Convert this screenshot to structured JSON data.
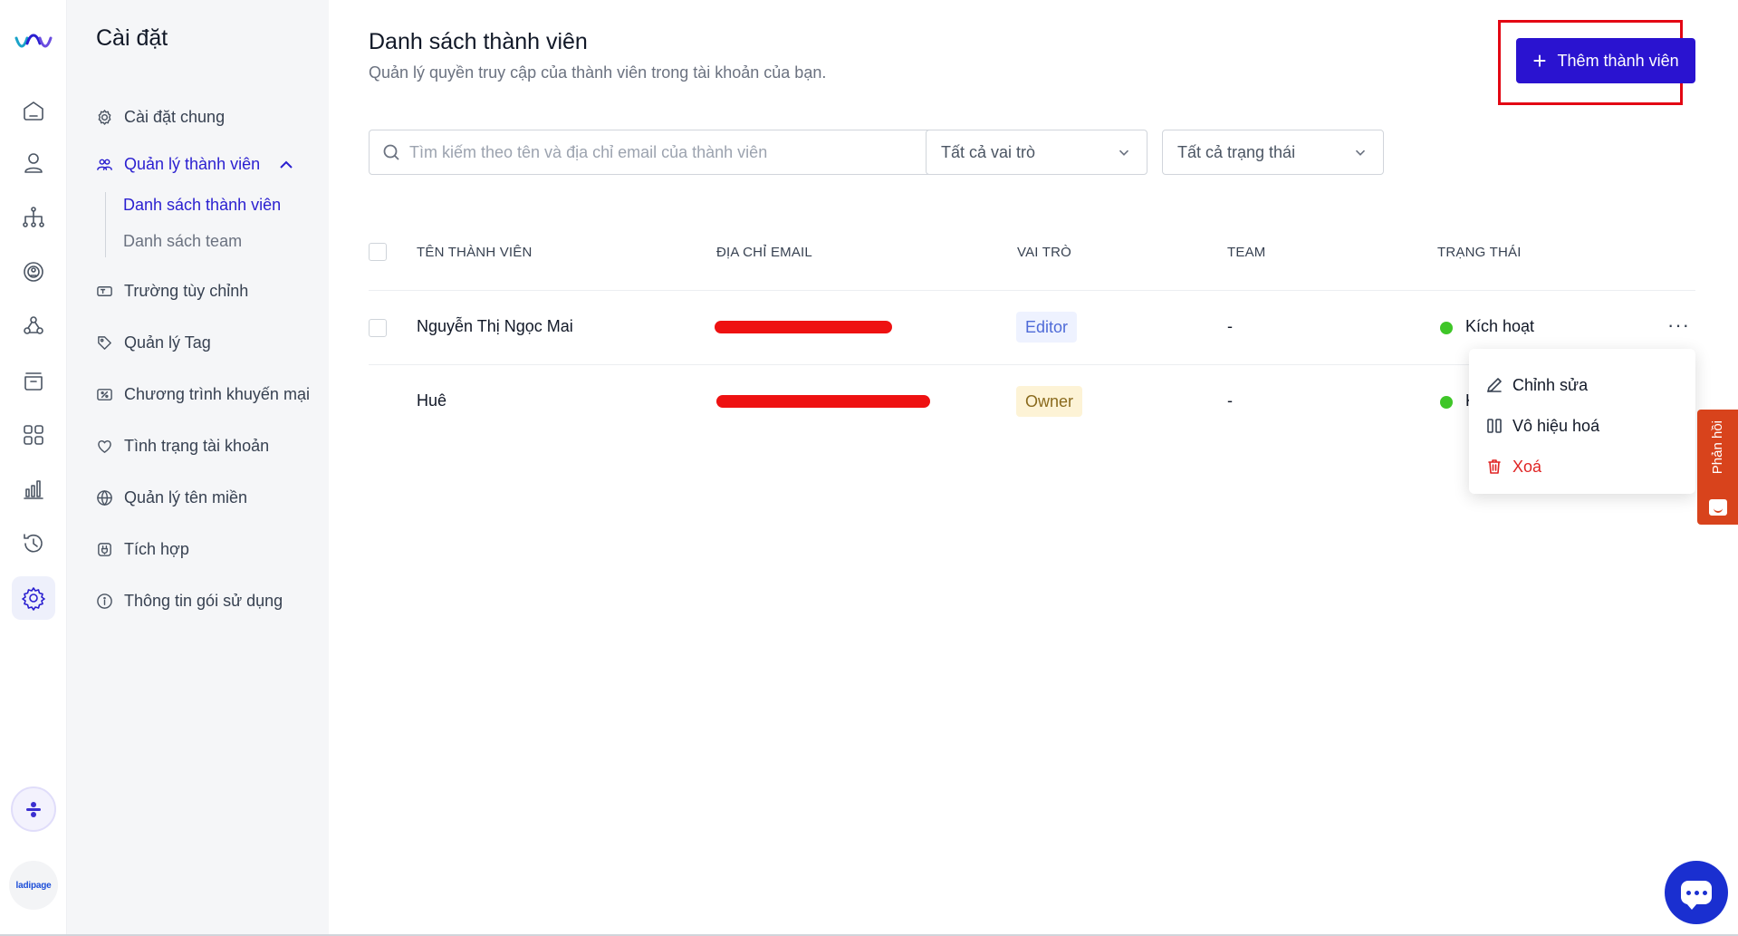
{
  "rail": {
    "icons": [
      "home-icon",
      "user-icon",
      "org-chart-icon",
      "broadcast-icon",
      "group-icon",
      "box-icon",
      "apps-icon",
      "bar-chart-icon",
      "history-icon",
      "settings-icon"
    ],
    "active": "settings-icon",
    "brand_label": "ladipage"
  },
  "sidebar": {
    "title": "Cài đặt",
    "items": [
      {
        "label": "Cài đặt chung",
        "icon": "gear-icon"
      },
      {
        "label": "Quản lý thành viên",
        "icon": "users-icon",
        "active": true,
        "expanded": true
      },
      {
        "label": "Trường tùy chỉnh",
        "icon": "text-field-icon"
      },
      {
        "label": "Quản lý Tag",
        "icon": "tag-icon"
      },
      {
        "label": "Chương trình khuyến mại",
        "icon": "discount-icon"
      },
      {
        "label": "Tình trạng tài khoản",
        "icon": "heart-icon"
      },
      {
        "label": "Quản lý tên miền",
        "icon": "globe-icon"
      },
      {
        "label": "Tích hợp",
        "icon": "plug-icon"
      },
      {
        "label": "Thông tin gói sử dụng",
        "icon": "info-icon"
      }
    ],
    "sub_items": [
      {
        "label": "Danh sách thành viên",
        "active": true
      },
      {
        "label": "Danh sách team"
      }
    ]
  },
  "header": {
    "title": "Danh sách thành viên",
    "subtitle": "Quản lý quyền truy cập của thành viên trong tài khoản của bạn.",
    "add_button": "Thêm thành viên"
  },
  "filters": {
    "search_placeholder": "Tìm kiếm theo tên và địa chỉ email của thành viên",
    "role_select": "Tất cả vai trò",
    "status_select": "Tất cả trạng thái"
  },
  "table": {
    "columns": [
      "TÊN THÀNH VIÊN",
      "ĐỊA CHỈ EMAIL",
      "VAI TRÒ",
      "TEAM",
      "TRẠNG THÁI"
    ],
    "rows": [
      {
        "name": "Nguyễn Thị Ngọc Mai",
        "email": "[redacted]",
        "role": "Editor",
        "team": "-",
        "status": "Kích hoạt"
      },
      {
        "name": "Huê",
        "email": "[redacted]",
        "role": "Owner",
        "team": "-",
        "status": "K"
      }
    ]
  },
  "row_menu": {
    "items": [
      {
        "label": "Chỉnh sửa",
        "icon": "pencil-icon"
      },
      {
        "label": "Vô hiệu hoá",
        "icon": "pause-icon"
      },
      {
        "label": "Xoá",
        "icon": "trash-icon",
        "danger": true
      }
    ]
  },
  "feedback": {
    "label": "Phản hồi"
  },
  "colors": {
    "accent": "#2a13d0",
    "danger": "#e02424",
    "status_active": "#3fc628",
    "highlight_box": "#e30613",
    "feedback": "#d8431c"
  }
}
